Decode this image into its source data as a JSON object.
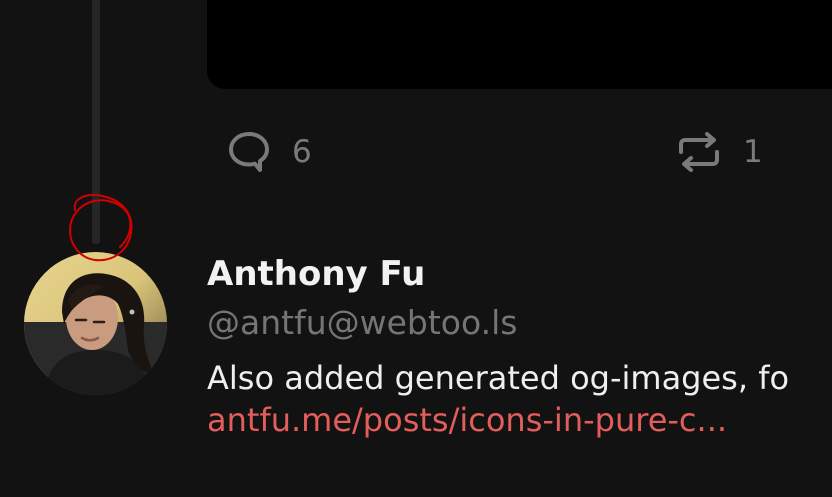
{
  "post_actions": {
    "reply_count": "6",
    "boost_count": "1"
  },
  "post": {
    "author_name": "Anthony Fu",
    "author_handle": "@antfu@webtoo.ls",
    "text": "Also added generated og-images, fo",
    "link_text": "antfu.me/posts/icons-in-pure-c..."
  },
  "icons": {
    "reply": "speech-bubble-icon",
    "boost": "repeat-icon"
  },
  "colors": {
    "background": "#121212",
    "link": "#e35d5d",
    "annotation": "#d10000"
  }
}
